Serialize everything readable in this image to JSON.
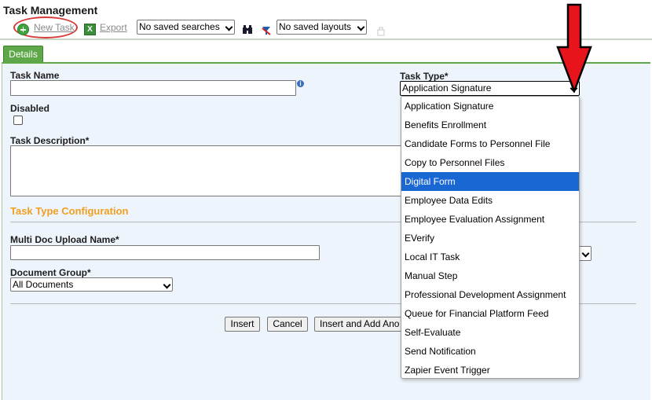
{
  "page": {
    "title": "Task Management"
  },
  "toolbar": {
    "new_task_label": "New Task",
    "export_label": "Export",
    "saved_searches": "No saved searches",
    "saved_layouts": "No saved layouts"
  },
  "tabs": {
    "details": "Details"
  },
  "form": {
    "task_name_label": "Task Name",
    "task_name_value": "",
    "info_glyph": "i",
    "disabled_label": "Disabled",
    "task_description_label": "Task Description*",
    "task_type_label": "Task Type*",
    "task_type_value": "Application Signature",
    "config_section_title": "Task Type Configuration",
    "multi_doc_label": "Multi Doc Upload Name*",
    "multi_doc_value": "",
    "document_group_label": "Document Group*",
    "document_group_value": "All Documents"
  },
  "buttons": {
    "insert": "Insert",
    "cancel": "Cancel",
    "insert_add_another": "Insert and Add Ano"
  },
  "task_type_options": [
    "Application Signature",
    "Benefits Enrollment",
    "Candidate Forms to Personnel File",
    "Copy to Personnel Files",
    "Digital Form",
    "Employee Data Edits",
    "Employee Evaluation Assignment",
    "EVerify",
    "Local IT Task",
    "Manual Step",
    "Professional Development Assignment",
    "Queue for Financial Platform Feed",
    "Self-Evaluate",
    "Send Notification",
    "Zapier Event Trigger"
  ],
  "task_type_highlighted": "Digital Form",
  "colors": {
    "accent_green": "#5fa84a",
    "section_orange": "#f0a020",
    "highlight_blue": "#1967d2",
    "annotation_red": "#e8141b"
  }
}
